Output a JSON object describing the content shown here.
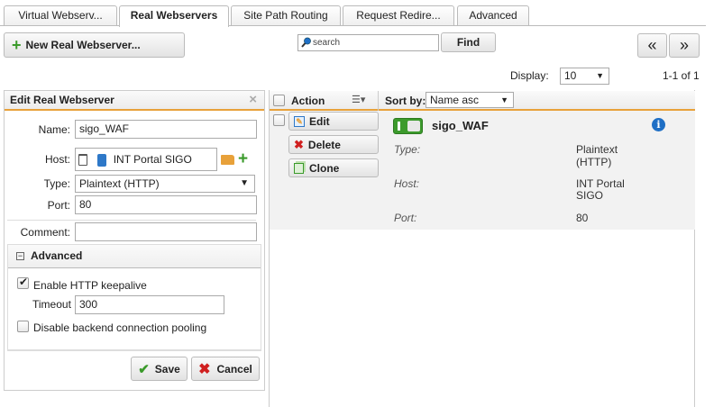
{
  "tabs": [
    {
      "label": "Virtual Webserv..."
    },
    {
      "label": "Real Webservers"
    },
    {
      "label": "Site Path Routing"
    },
    {
      "label": "Request Redire..."
    },
    {
      "label": "Advanced"
    }
  ],
  "toolbar": {
    "new_label": "New Real Webserver...",
    "search_placeholder": "search",
    "find_label": "Find",
    "prev_page": "«",
    "next_page": "»"
  },
  "pagination": {
    "display_label": "Display:",
    "display_value": "10",
    "range": "1-1 of 1"
  },
  "edit_panel": {
    "title": "Edit Real Webserver",
    "name_label": "Name:",
    "name_value": "sigo_WAF",
    "host_label": "Host:",
    "host_value": "INT Portal SIGO",
    "type_label": "Type:",
    "type_value": "Plaintext (HTTP)",
    "port_label": "Port:",
    "port_value": "80",
    "comment_label": "Comment:",
    "comment_value": "",
    "advanced_title": "Advanced",
    "keepalive_label": "Enable HTTP keepalive",
    "keepalive_checked": true,
    "timeout_label": "Timeout",
    "timeout_value": "300",
    "pooling_label": "Disable backend connection pooling",
    "pooling_checked": false,
    "save_label": "Save",
    "cancel_label": "Cancel"
  },
  "list": {
    "action_header": "Action",
    "sortby_label": "Sort by:",
    "sortby_value": "Name asc",
    "edit_label": "Edit",
    "delete_label": "Delete",
    "clone_label": "Clone",
    "item": {
      "name": "sigo_WAF",
      "type_label": "Type:",
      "type_value_1": "Plaintext",
      "type_value_2": "(HTTP)",
      "host_label": "Host:",
      "host_value_1": "INT Portal",
      "host_value_2": "SIGO",
      "port_label": "Port:",
      "port_value": "80"
    }
  },
  "colors": {
    "accent_orange": "#e8a13a",
    "toggle_green": "#3c9a2c",
    "info_blue": "#1f6fc5",
    "add_green": "#3a9a2a",
    "cancel_red": "#d02020"
  }
}
